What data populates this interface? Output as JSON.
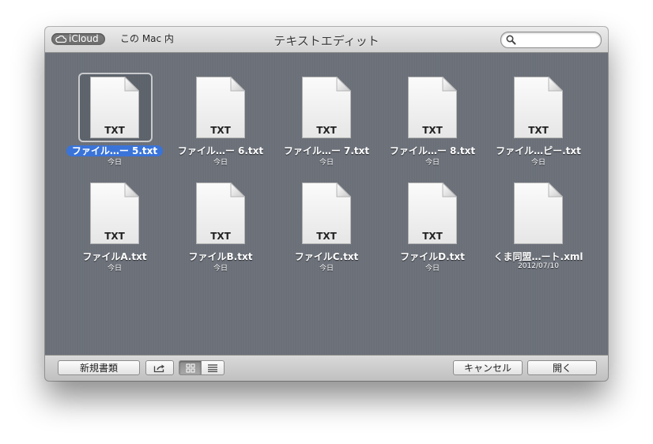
{
  "window": {
    "title": "テキストエディット"
  },
  "toolbar": {
    "icloud_label": "iCloud",
    "mac_label": "この Mac 内",
    "search_placeholder": ""
  },
  "files": [
    {
      "name": "ファイル…ー 5.txt",
      "date": "今日",
      "ext": "TXT",
      "selected": true
    },
    {
      "name": "ファイル…ー 6.txt",
      "date": "今日",
      "ext": "TXT"
    },
    {
      "name": "ファイル…ー 7.txt",
      "date": "今日",
      "ext": "TXT"
    },
    {
      "name": "ファイル…ー 8.txt",
      "date": "今日",
      "ext": "TXT"
    },
    {
      "name": "ファイル…ピー.txt",
      "date": "今日",
      "ext": "TXT"
    },
    {
      "name": "ファイルA.txt",
      "date": "今日",
      "ext": "TXT"
    },
    {
      "name": "ファイルB.txt",
      "date": "今日",
      "ext": "TXT"
    },
    {
      "name": "ファイルC.txt",
      "date": "今日",
      "ext": "TXT"
    },
    {
      "name": "ファイルD.txt",
      "date": "今日",
      "ext": "TXT"
    },
    {
      "name": "くま同盟…ート.xml",
      "date": "2012/07/10",
      "ext": ""
    }
  ],
  "bottombar": {
    "new_document_label": "新規書類",
    "share_icon": "share-icon",
    "icon_view_icon": "grid-icon",
    "list_view_icon": "list-icon",
    "view_mode": "icon",
    "cancel_label": "キャンセル",
    "open_label": "開く"
  },
  "colors": {
    "selection": "#3a74d9",
    "content_background": "#6b7079"
  }
}
